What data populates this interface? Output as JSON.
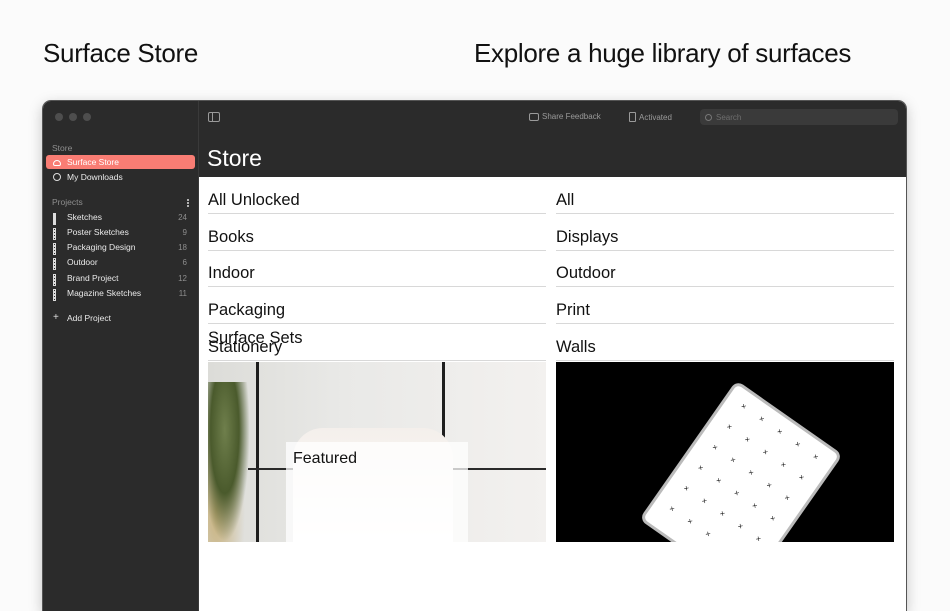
{
  "headlines": {
    "left": "Surface Store",
    "right": "Explore a huge library of surfaces"
  },
  "sidebar": {
    "store_section": "Store",
    "store_items": [
      {
        "label": "Surface Store",
        "icon": "cloud-icon",
        "active": true
      },
      {
        "label": "My Downloads",
        "icon": "download-icon",
        "active": false
      }
    ],
    "projects_section": "Projects",
    "projects": [
      {
        "label": "Sketches",
        "count": "24"
      },
      {
        "label": "Poster Sketches",
        "count": "9"
      },
      {
        "label": "Packaging Design",
        "count": "18"
      },
      {
        "label": "Outdoor",
        "count": "6"
      },
      {
        "label": "Brand Project",
        "count": "12"
      },
      {
        "label": "Magazine Sketches",
        "count": "11"
      }
    ],
    "add_project": "Add Project"
  },
  "toolbar": {
    "share_feedback": "Share Feedback",
    "activated": "Activated",
    "search_placeholder": "Search"
  },
  "main": {
    "title": "Store",
    "categories_left": [
      "All Unlocked",
      "Books",
      "Indoor",
      "Packaging",
      "Stationery"
    ],
    "categories_right": [
      "All",
      "Displays",
      "Outdoor",
      "Print",
      "Walls"
    ],
    "section_title": "Surface Sets",
    "featured_label": "Featured"
  },
  "colors": {
    "accent": "#f97d74",
    "sidebar_bg": "#2b2b2b"
  }
}
